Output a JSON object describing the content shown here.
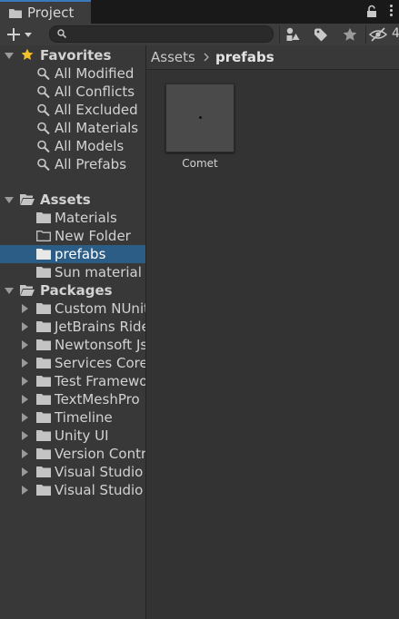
{
  "window": {
    "tab_label": "Project",
    "hidden_packages_count": "4"
  },
  "toolbar": {
    "search_value": "",
    "create_icon": "plus-icon",
    "buttons": [
      "search-by-type-icon",
      "search-by-label-icon",
      "favorites-star-icon",
      "hidden-packages-eye-icon"
    ]
  },
  "tree": {
    "favorites": {
      "label": "Favorites",
      "items": [
        "All Modified",
        "All Conflicts",
        "All Excluded",
        "All Materials",
        "All Models",
        "All Prefabs"
      ]
    },
    "assets": {
      "label": "Assets",
      "items": [
        {
          "label": "Materials",
          "icon": "folder-icon",
          "selected": false
        },
        {
          "label": "New Folder",
          "icon": "empty-folder-icon",
          "selected": false
        },
        {
          "label": "prefabs",
          "icon": "folder-icon",
          "selected": true
        },
        {
          "label": "Sun material",
          "icon": "folder-icon",
          "selected": false
        }
      ]
    },
    "packages": {
      "label": "Packages",
      "items": [
        "Custom NUnit",
        "JetBrains Rider Editor",
        "Newtonsoft Json",
        "Services Core",
        "Test Framework",
        "TextMeshPro",
        "Timeline",
        "Unity UI",
        "Version Control",
        "Visual Studio Code Editor",
        "Visual Studio Editor"
      ]
    }
  },
  "breadcrumb": {
    "root": "Assets",
    "current": "prefabs"
  },
  "assets_grid": [
    {
      "name": "Comet",
      "type": "prefab"
    }
  ],
  "colors": {
    "selection": "#2c5d87",
    "tab_accent": "#3a79bb",
    "star": "#f4c12b"
  }
}
